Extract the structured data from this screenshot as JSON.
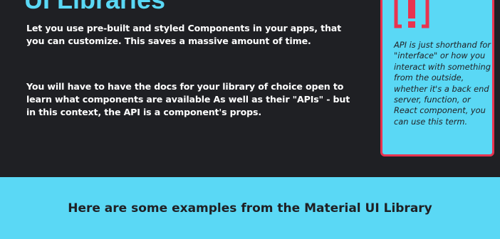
{
  "colors": {
    "dark_background": "#1f2024",
    "accent_cyan": "#5ad8f5",
    "accent_red": "#e8334f",
    "text_light": "#ffffff",
    "text_dark": "#1f2024"
  },
  "main": {
    "heading": "UI Libraries",
    "paragraphs": [
      "Let you use pre-built and styled Components in your apps, that you can customize. This saves a massive amount of time.",
      "You will have to have the docs for your library of choice open to learn what components are available As well as their \"APIs\" - but in this context, the API is a component's props."
    ]
  },
  "callout": {
    "icon": "exclamation-bracket-icon",
    "text": "API is just shorthand for \"interface\" or how you interact with something from the outside, whether it's a back end server, function, or React component, you can use this term."
  },
  "footer": {
    "heading": "Here are some examples from the Material UI Library"
  }
}
